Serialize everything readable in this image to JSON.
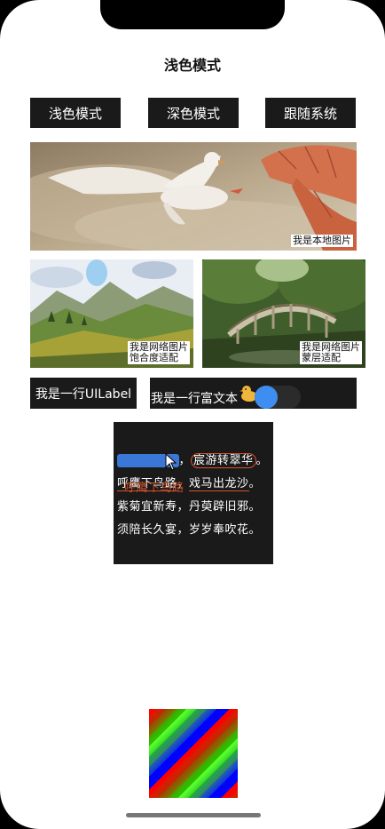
{
  "page": {
    "title": "浅色模式"
  },
  "mode_buttons": [
    {
      "label": "浅色模式"
    },
    {
      "label": "深色模式"
    },
    {
      "label": "跟随系统"
    }
  ],
  "images": {
    "local": {
      "caption": "我是本地图片"
    },
    "network_saturation": {
      "caption_line1": "我是网络图片",
      "caption_line2": "饱合度适配"
    },
    "network_mask": {
      "caption_line1": "我是网络图片",
      "caption_line2": "蒙层适配"
    }
  },
  "uilabel": {
    "text": "我是一行UILabel"
  },
  "rich_text": {
    "text": "我是一行富文本",
    "icon": "duck-icon",
    "toggle_on": false,
    "toggle_color": "#3d8ef0"
  },
  "poem": {
    "line1_a": "红旗漫卷风",
    "line1_sep": "，",
    "line1_b": "宸游转翠华",
    "line1_end": "。",
    "line2_a": "呼鹰下鸟路",
    "line2_sep": "，",
    "line2_b": "戏马出龙沙",
    "line2_end": "。",
    "line3": "紫菊宜新寿，丹萸辟旧邪。",
    "line4": "须陪长久宴，岁岁奉吹花。",
    "overlay": "呼鹰下鸟路"
  },
  "colors": {
    "accent_red": "#d9532a",
    "highlight_blue": "#3a77d6",
    "button_bg": "#1a1a1a"
  }
}
